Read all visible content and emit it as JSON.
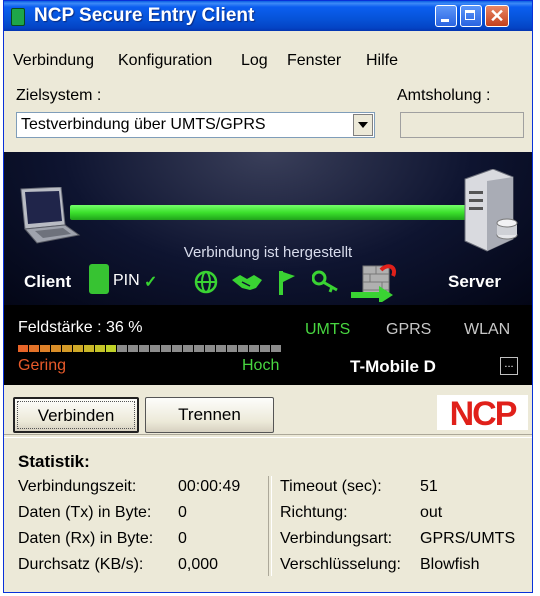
{
  "window": {
    "title": "NCP Secure Entry Client"
  },
  "menu": {
    "items": [
      "Verbindung",
      "Konfiguration",
      "Log",
      "Fenster",
      "Hilfe"
    ]
  },
  "zielsystem": {
    "label": "Zielsystem :",
    "value": "Testverbindung über UMTS/GPRS"
  },
  "amtsholung": {
    "label": "Amtsholung :",
    "value": ""
  },
  "status": {
    "message": "Verbindung ist hergestellt",
    "client_label": "Client",
    "pin_label": "PIN",
    "pin_check": "✓",
    "server_label": "Server",
    "connected": true
  },
  "signal": {
    "label": "Feldstärke : 36 %",
    "strength_percent": 36,
    "networks": [
      {
        "name": "UMTS",
        "active": true
      },
      {
        "name": "GPRS",
        "active": false
      },
      {
        "name": "WLAN",
        "active": false
      }
    ],
    "low_label": "Gering",
    "high_label": "Hoch",
    "provider": "T-Mobile D",
    "details_button": "..."
  },
  "buttons": {
    "connect": "Verbinden",
    "disconnect": "Trennen"
  },
  "logo": {
    "text": "NCP"
  },
  "statistics": {
    "title": "Statistik:",
    "left": [
      {
        "label": "Verbindungszeit:",
        "value": "00:00:49"
      },
      {
        "label": "Daten (Tx) in Byte:",
        "value": "0"
      },
      {
        "label": "Daten (Rx) in Byte:",
        "value": "0"
      },
      {
        "label": "Durchsatz (KB/s):",
        "value": "0,000"
      }
    ],
    "right": [
      {
        "label": "Timeout (sec):",
        "value": "51"
      },
      {
        "label": "Richtung:",
        "value": "out"
      },
      {
        "label": "Verbindungsart:",
        "value": "GPRS/UMTS"
      },
      {
        "label": "Verschlüsselung:",
        "value": "Blowfish"
      }
    ]
  },
  "colors": {
    "title_bar": "#0653d8",
    "connection_bar": "#3be02c",
    "active_network": "#48d640",
    "inactive_network": "#c8c8c8",
    "logo_red": "#e0201a"
  }
}
